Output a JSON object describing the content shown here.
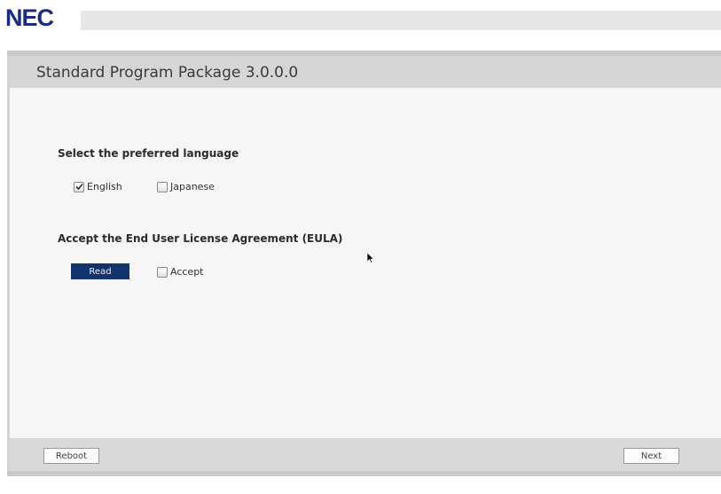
{
  "brand": {
    "logo_text": "NEC",
    "logo_color": "#1b2a86"
  },
  "window": {
    "title": "Standard Program Package 3.0.0.0"
  },
  "language_section": {
    "heading": "Select the preferred language",
    "options": [
      {
        "label": "English",
        "checked": true
      },
      {
        "label": "Japanese",
        "checked": false
      }
    ]
  },
  "eula_section": {
    "heading": "Accept the End User License Agreement (EULA)",
    "read_button_label": "Read",
    "accept_label": "Accept",
    "accept_checked": false
  },
  "footer": {
    "reboot_label": "Reboot",
    "next_label": "Next"
  },
  "colors": {
    "read_button": "#12336b",
    "title_bar": "#d6d6d6",
    "content_bg": "#f6f6f6"
  },
  "icons": {
    "checkmark": "check-icon",
    "pointer": "mouse-pointer-icon"
  }
}
